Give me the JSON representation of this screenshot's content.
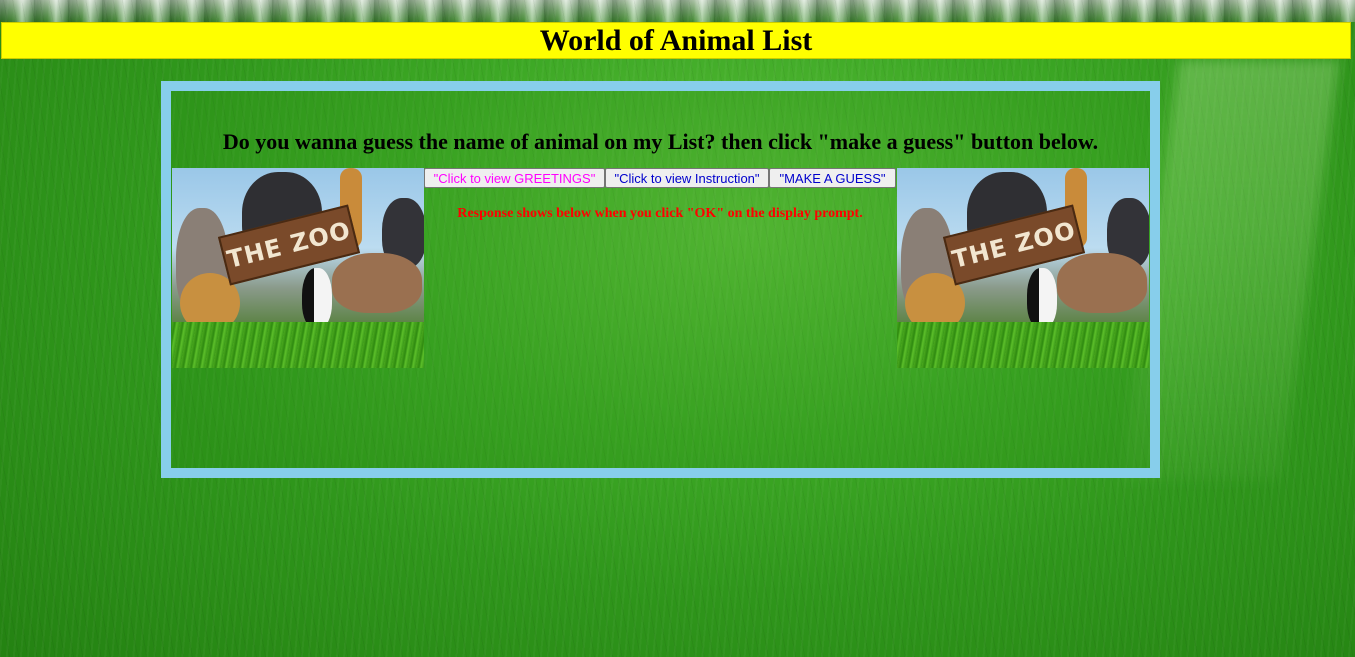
{
  "page": {
    "title": "World of Animal List"
  },
  "game": {
    "heading": "Do you wanna guess the name of animal on my List? then click \"make a guess\" button below.",
    "image_left": {
      "sign_text": "THE ZOO"
    },
    "image_right": {
      "sign_text": "THE ZOO"
    },
    "buttons": {
      "greetings": "\"Click to view GREETINGS\"",
      "instruction": "\"Click to view Instruction\"",
      "guess": "\"MAKE A GUESS\""
    },
    "response_note": "Response shows below when you click \"OK\" on the display prompt."
  },
  "colors": {
    "header_bg": "#ffff00",
    "box_border": "#87ceeb",
    "greetings_text": "#ff00ff",
    "button_text": "#0000cd",
    "response_text": "#ff0000"
  }
}
